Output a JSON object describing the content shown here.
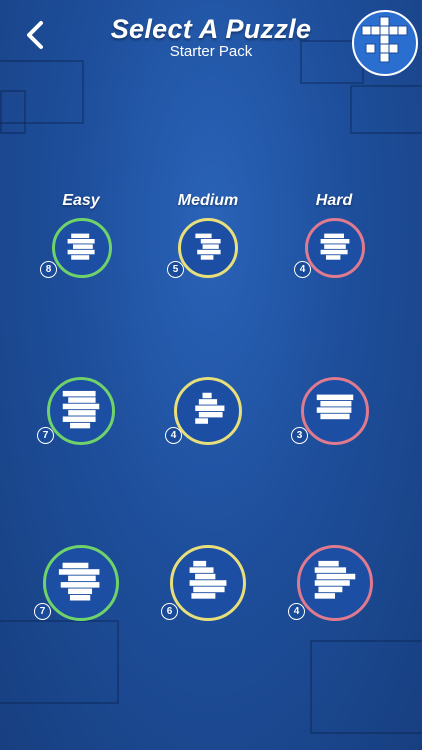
{
  "header": {
    "title": "Select A Puzzle",
    "subtitle": "Starter Pack",
    "back_icon": "chevron-left-icon",
    "logo_icon": "start-crossword-logo"
  },
  "columns": [
    {
      "label": "Easy",
      "color": "#6fd36a"
    },
    {
      "label": "Medium",
      "color": "#e8df7a"
    },
    {
      "label": "Hard",
      "color": "#e07a8e"
    }
  ],
  "puzzles": [
    {
      "count": "8"
    },
    {
      "count": "5"
    },
    {
      "count": "4"
    },
    {
      "count": "7"
    },
    {
      "count": "4"
    },
    {
      "count": "3"
    },
    {
      "count": "7"
    },
    {
      "count": "6"
    },
    {
      "count": "4"
    }
  ]
}
